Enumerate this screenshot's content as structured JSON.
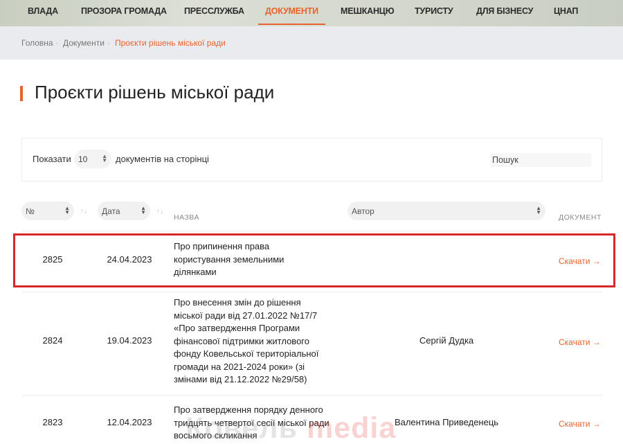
{
  "nav": {
    "items": [
      {
        "label": "ВЛАДА",
        "active": false
      },
      {
        "label": "ПРОЗОРА ГРОМАДА",
        "active": false
      },
      {
        "label": "ПРЕССЛУЖБА",
        "active": false
      },
      {
        "label": "ДОКУМЕНТИ",
        "active": true
      },
      {
        "label": "МЕШКАНЦЮ",
        "active": false
      },
      {
        "label": "ТУРИСТУ",
        "active": false
      },
      {
        "label": "ДЛЯ БІЗНЕСУ",
        "active": false
      },
      {
        "label": "ЦНАП",
        "active": false
      }
    ]
  },
  "breadcrumb": {
    "home": "Головна",
    "docs": "Документи",
    "current": "Проєкти рішень міської ради",
    "separator": "·"
  },
  "page": {
    "title": "Проєкти рішень міської ради"
  },
  "filters": {
    "show_label": "Показати",
    "per_page_value": "10",
    "docs_label": "документів на сторінці",
    "search_placeholder": "Пошук",
    "search_value": ""
  },
  "table": {
    "headers": {
      "num": "№",
      "date": "Дата",
      "name": "НАЗВА",
      "author": "Автор",
      "document": "ДОКУМЕНТ"
    },
    "rows": [
      {
        "num": "2825",
        "date": "24.04.2023",
        "name": "Про припинення права користування земельними ділянками",
        "author": "",
        "download": "Скачати"
      },
      {
        "num": "2824",
        "date": "19.04.2023",
        "name": "Про внесення змін до рішення міської ради від 27.01.2022 №17/7 «Про затвердження Програми фінансової підтримки житлового фонду Ковельської територіальної громади на 2021-2024 роки» (зі змінами від 21.12.2022 №29/58)",
        "author": "Сергій Дудка",
        "download": "Скачати"
      },
      {
        "num": "2823",
        "date": "12.04.2023",
        "name": "Про затвердження порядку денного тридцять четвертої сесії міської ради восьмого скликання",
        "author": "Валентина Приведенець",
        "download": "Скачати"
      }
    ]
  },
  "watermark": {
    "part1": "Ковель",
    "part2": "media"
  },
  "colors": {
    "accent": "#e8622b",
    "highlight": "#d9262c"
  },
  "icons": {
    "sort": "sort-arrows-icon",
    "download": "arrow-right-icon",
    "select": "select-arrows-icon"
  }
}
